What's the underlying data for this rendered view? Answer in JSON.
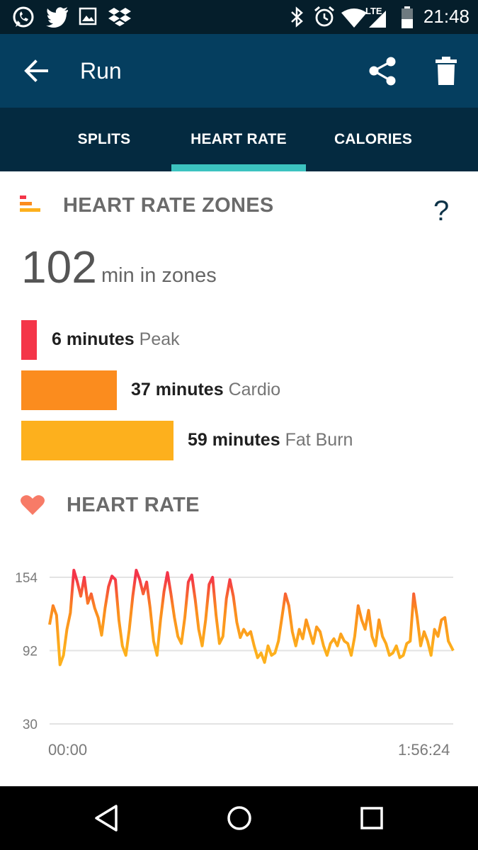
{
  "status_bar": {
    "time": "21:48",
    "left_icons": [
      "whatsapp-icon",
      "twitter-icon",
      "gallery-icon",
      "dropbox-icon"
    ],
    "right_icons": [
      "bluetooth-icon",
      "alarm-icon",
      "signal-lte-icon",
      "battery-icon"
    ],
    "network_label": "LTE"
  },
  "app_bar": {
    "title": "Run",
    "icons": [
      "back-arrow-icon",
      "share-icon",
      "trash-icon"
    ]
  },
  "tabs": [
    {
      "label": "SPLITS",
      "selected": false
    },
    {
      "label": "HEART RATE",
      "selected": true
    },
    {
      "label": "CALORIES",
      "selected": false
    }
  ],
  "zones": {
    "title": "HEART RATE ZONES",
    "help": "?",
    "total_value": "102",
    "total_unit": "min in zones",
    "items": [
      {
        "value": "6 minutes",
        "name": "Peak",
        "minutes": 6,
        "color": "#f43549"
      },
      {
        "value": "37 minutes",
        "name": "Cardio",
        "minutes": 37,
        "color": "#fb8c1e"
      },
      {
        "value": "59 minutes",
        "name": "Fat Burn",
        "minutes": 59,
        "color": "#fdb01d"
      }
    ]
  },
  "heart_rate": {
    "title": "HEART RATE",
    "colors": {
      "high": "#f43549",
      "mid": "#fb8c1e",
      "low": "#fdb01d",
      "heart": "#f77b67"
    }
  },
  "chart_data": {
    "type": "line",
    "title": "",
    "xlabel": "",
    "ylabel": "",
    "y_ticks": [
      154,
      92,
      30
    ],
    "ylim": [
      30,
      154
    ],
    "x_tick_labels": [
      "00:00",
      "1:56:24"
    ],
    "x_unit": "minutes",
    "xlim": [
      0,
      116.4
    ],
    "grid": true,
    "series": [
      {
        "x": [
          0,
          1,
          2,
          3,
          4,
          5,
          6,
          7,
          8,
          9,
          10,
          11,
          12,
          13,
          14,
          15,
          16,
          17,
          18,
          19,
          20,
          21,
          22,
          23,
          24,
          25,
          26,
          27,
          28,
          29,
          30,
          31,
          32,
          33,
          34,
          35,
          36,
          37,
          38,
          39,
          40,
          41,
          42,
          43,
          44,
          45,
          46,
          47,
          48,
          49,
          50,
          51,
          52,
          53,
          54,
          55,
          56,
          57,
          58,
          59,
          60,
          61,
          62,
          63,
          64,
          65,
          66,
          67,
          68,
          69,
          70,
          71,
          72,
          73,
          74,
          75,
          76,
          77,
          78,
          79,
          80,
          81,
          82,
          83,
          84,
          85,
          86,
          87,
          88,
          89,
          90,
          91,
          92,
          93,
          94,
          95,
          96,
          97,
          98,
          99,
          100,
          101,
          102,
          103,
          104,
          105,
          106,
          107,
          108,
          109,
          110,
          111,
          112,
          113,
          114,
          115,
          116.4
        ],
        "y": [
          114,
          130,
          122,
          80,
          88,
          110,
          124,
          160,
          150,
          138,
          154,
          132,
          140,
          128,
          120,
          105,
          128,
          146,
          155,
          152,
          118,
          96,
          88,
          110,
          138,
          160,
          152,
          140,
          150,
          128,
          100,
          88,
          118,
          142,
          158,
          140,
          120,
          104,
          98,
          120,
          150,
          156,
          135,
          110,
          96,
          118,
          148,
          154,
          122,
          98,
          104,
          136,
          152,
          138,
          116,
          103,
          110,
          105,
          108,
          96,
          86,
          90,
          82,
          96,
          88,
          90,
          100,
          120,
          140,
          130,
          108,
          96,
          110,
          102,
          118,
          108,
          98,
          112,
          108,
          96,
          88,
          98,
          102,
          96,
          106,
          100,
          98,
          88,
          104,
          130,
          118,
          110,
          126,
          104,
          96,
          118,
          104,
          98,
          88,
          90,
          96,
          86,
          88,
          98,
          100,
          140,
          120,
          96,
          108,
          100,
          88,
          110,
          104,
          118,
          120,
          100,
          92
        ]
      }
    ]
  },
  "nav_bar": {
    "icons": [
      "nav-back-icon",
      "nav-home-icon",
      "nav-recents-icon"
    ]
  }
}
